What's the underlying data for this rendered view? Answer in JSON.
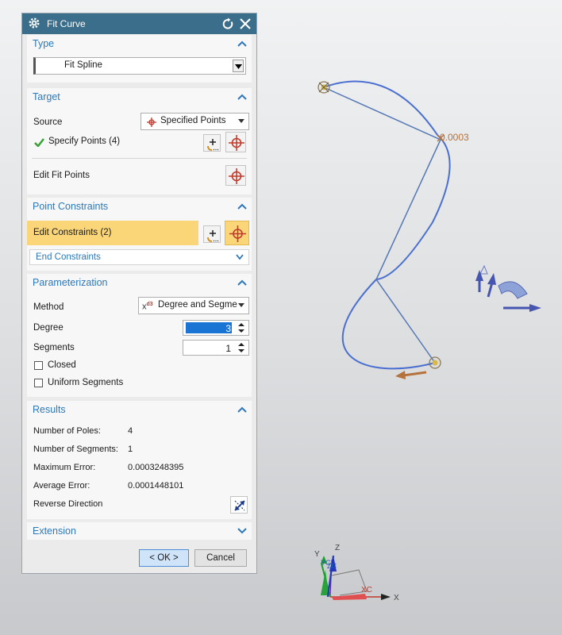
{
  "dialog": {
    "title": "Fit Curve",
    "icons": {
      "title": "gear-icon",
      "reset": "reset-icon",
      "close": "close-icon"
    }
  },
  "type_section": {
    "header": "Type",
    "selected": "Fit Spline"
  },
  "target_section": {
    "header": "Target",
    "source_label": "Source",
    "source_value": "Specified Points",
    "specify_points_label": "Specify Points (4)",
    "edit_fit_points_label": "Edit Fit Points"
  },
  "constraints_section": {
    "header": "Point Constraints",
    "edit_constraints_label": "Edit Constraints (2)",
    "end_constraints_label": "End Constraints"
  },
  "param_section": {
    "header": "Parameterization",
    "method_label": "Method",
    "method_prefix": "x",
    "method_exp": "d",
    "method_power": "3",
    "method_value": "Degree and Segme",
    "degree_label": "Degree",
    "degree_value": "3",
    "segments_label": "Segments",
    "segments_value": "1",
    "closed_label": "Closed",
    "uniform_label": "Uniform Segments"
  },
  "results_section": {
    "header": "Results",
    "rows": [
      {
        "label": "Number of Poles:",
        "value": "4"
      },
      {
        "label": "Number of Segments:",
        "value": "1"
      },
      {
        "label": "Maximum Error:",
        "value": "0.0003248395"
      },
      {
        "label": "Average Error:",
        "value": "0.0001448101"
      }
    ],
    "reverse_label": "Reverse Direction"
  },
  "extension_section": {
    "header": "Extension"
  },
  "buttons": {
    "ok": "< OK >",
    "cancel": "Cancel"
  },
  "viewport": {
    "error_label": "0.0003",
    "axis_labels": {
      "x": "X",
      "y": "Y",
      "z": "Z",
      "xc": "XC",
      "yc": "YC",
      "zc": "ZC"
    }
  },
  "colors": {
    "accent": "#2d78b8",
    "titlebar": "#3b6e8a",
    "highlight": "#fbd679",
    "curve": "#4a6fd0",
    "label_orange": "#b5723b"
  }
}
